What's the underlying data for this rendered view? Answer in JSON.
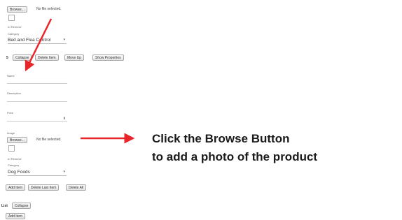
{
  "file1": {
    "browse_label": "Browse...",
    "status": "No file selected."
  },
  "checkbox1": {
    "label": "Remove"
  },
  "category1": {
    "label": "Category",
    "value": "Bed and Flea Control"
  },
  "toolbar1": {
    "buttons": [
      "Collapse",
      "Delete Item",
      "Move Up",
      "Show Properties"
    ]
  },
  "fields": {
    "name_label": "Name",
    "desc_label": "Description",
    "price_label": "Price"
  },
  "file2": {
    "image_label": "Image",
    "browse_label": "Browse...",
    "status": "No file selected."
  },
  "checkbox2": {
    "label": "Remove"
  },
  "category2": {
    "label": "Category",
    "value": "Dog Foods"
  },
  "toolbar2": {
    "buttons": [
      "Add Item",
      "Delete Last Item",
      "Delete All"
    ]
  },
  "list": {
    "label": "List",
    "collapse_label": "Collapse"
  },
  "bottom": {
    "add_item_label": "Add Item"
  },
  "callout": {
    "line1": "Click the Browse Button",
    "line2": "to add a photo of the product"
  },
  "colors": {
    "arrow": "#e8262a",
    "text": "#1a1a1a"
  }
}
